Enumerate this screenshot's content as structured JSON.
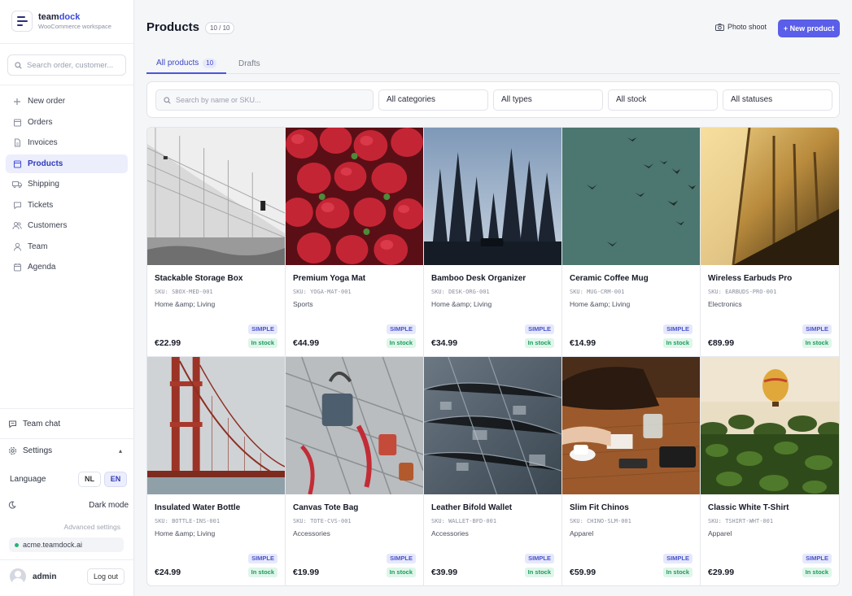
{
  "brand": {
    "name_a": "team",
    "name_b": "dock",
    "subtitle": "WooCommerce workspace",
    "accent": "#3b4bd8"
  },
  "sidebar": {
    "search_placeholder": "Search order, customer...",
    "items": [
      {
        "label": "New order",
        "icon": "plus-icon"
      },
      {
        "label": "Orders",
        "icon": "bag-icon"
      },
      {
        "label": "Invoices",
        "icon": "file-icon"
      },
      {
        "label": "Products",
        "icon": "box-icon",
        "active": true
      },
      {
        "label": "Shipping",
        "icon": "truck-icon"
      },
      {
        "label": "Tickets",
        "icon": "chat-bubble-icon"
      },
      {
        "label": "Customers",
        "icon": "users-icon"
      },
      {
        "label": "Team",
        "icon": "user-icon"
      },
      {
        "label": "Agenda",
        "icon": "calendar-icon"
      }
    ],
    "team_chat": "Team chat",
    "settings": "Settings",
    "language_label": "Language",
    "lang_nl": "NL",
    "lang_en": "EN",
    "dark_mode": "Dark mode",
    "advanced": "Advanced settings",
    "domain": "acme.teamdock.ai",
    "user": "admin",
    "logout": "Log out"
  },
  "header": {
    "title": "Products",
    "count": "10 / 10",
    "photo_shoot": "Photo shoot",
    "new_product": "+ New product",
    "primary_color": "#5a5ee8"
  },
  "tabs": [
    {
      "label": "All products",
      "count": "10",
      "active": true
    },
    {
      "label": "Drafts"
    }
  ],
  "filters": {
    "search_placeholder": "Search by name or SKU...",
    "categories": "All categories",
    "types": "All types",
    "stock": "All stock",
    "statuses": "All statuses"
  },
  "products": [
    {
      "name": "Stackable Storage Box",
      "sku": "SKU: SBOX-MED-001",
      "category": "Home &amp; Living",
      "price": "€22.99",
      "type": "SIMPLE",
      "stock": "In stock"
    },
    {
      "name": "Premium Yoga Mat",
      "sku": "SKU: YOGA-MAT-001",
      "category": "Sports",
      "price": "€44.99",
      "type": "SIMPLE",
      "stock": "In stock"
    },
    {
      "name": "Bamboo Desk Organizer",
      "sku": "SKU: DESK-ORG-001",
      "category": "Home &amp; Living",
      "price": "€34.99",
      "type": "SIMPLE",
      "stock": "In stock"
    },
    {
      "name": "Ceramic Coffee Mug",
      "sku": "SKU: MUG-CRM-001",
      "category": "Home &amp; Living",
      "price": "€14.99",
      "type": "SIMPLE",
      "stock": "In stock"
    },
    {
      "name": "Wireless Earbuds Pro",
      "sku": "SKU: EARBUDS-PRO-001",
      "category": "Electronics",
      "price": "€89.99",
      "type": "SIMPLE",
      "stock": "In stock"
    },
    {
      "name": "Insulated Water Bottle",
      "sku": "SKU: BOTTLE-INS-001",
      "category": "Home &amp; Living",
      "price": "€24.99",
      "type": "SIMPLE",
      "stock": "In stock"
    },
    {
      "name": "Canvas Tote Bag",
      "sku": "SKU: TOTE-CVS-001",
      "category": "Accessories",
      "price": "€19.99",
      "type": "SIMPLE",
      "stock": "In stock"
    },
    {
      "name": "Leather Bifold Wallet",
      "sku": "SKU: WALLET-BFD-001",
      "category": "Accessories",
      "price": "€39.99",
      "type": "SIMPLE",
      "stock": "In stock"
    },
    {
      "name": "Slim Fit Chinos",
      "sku": "SKU: CHINO-SLM-001",
      "category": "Apparel",
      "price": "€59.99",
      "type": "SIMPLE",
      "stock": "In stock"
    },
    {
      "name": "Classic White T-Shirt",
      "sku": "SKU: TSHIRT-WHT-001",
      "category": "Apparel",
      "price": "€29.99",
      "type": "SIMPLE",
      "stock": "In stock"
    }
  ]
}
